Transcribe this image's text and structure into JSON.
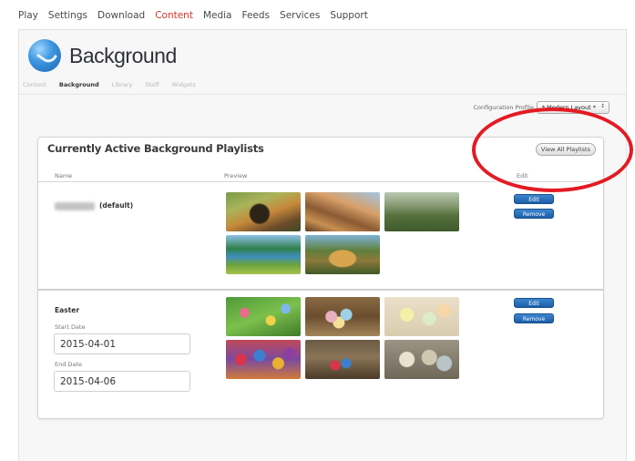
{
  "nav": {
    "items": [
      {
        "label": "Play",
        "active": false
      },
      {
        "label": "Settings",
        "active": false
      },
      {
        "label": "Download",
        "active": false
      },
      {
        "label": "Content",
        "active": true
      },
      {
        "label": "Media",
        "active": false
      },
      {
        "label": "Feeds",
        "active": false
      },
      {
        "label": "Services",
        "active": false
      },
      {
        "label": "Support",
        "active": false
      }
    ]
  },
  "header": {
    "title": "Background",
    "logo_icon": "globe-icon"
  },
  "subnav": {
    "items": [
      {
        "label": "Content",
        "active": false
      },
      {
        "label": "Background",
        "active": true
      },
      {
        "label": "Library",
        "active": false
      },
      {
        "label": "Staff",
        "active": false
      },
      {
        "label": "Widgets",
        "active": false
      }
    ]
  },
  "config": {
    "label": "Configuration Profile",
    "value": "* Modern Layout *"
  },
  "playlists": {
    "title": "Currently Active Background Playlists",
    "view_all_label": "View All Playlists",
    "columns": {
      "name": "Name",
      "preview": "Preview",
      "edit": "Edit"
    },
    "rows": [
      {
        "name": "(default)",
        "edit_label": "Edit",
        "remove_label": "Remove",
        "thumbnails": [
          "cycling-photo",
          "hikers-photo",
          "hills-photo",
          "lake-photo",
          "building-photo"
        ]
      },
      {
        "name": "Easter",
        "start_label": "Start Date",
        "start_value": "2015-04-01",
        "end_label": "End Date",
        "end_value": "2015-04-06",
        "edit_label": "Edit",
        "remove_label": "Remove",
        "thumbnails": [
          "eggs-grass-photo",
          "eggs-nest-photo",
          "pastel-eggs-photo",
          "colored-eggs-photo",
          "eggs-basket-photo",
          "speckled-eggs-photo"
        ]
      }
    ]
  },
  "colors": {
    "active_nav": "#d9332c",
    "button": "#2a6fbb",
    "annotation": "#e31b23"
  }
}
